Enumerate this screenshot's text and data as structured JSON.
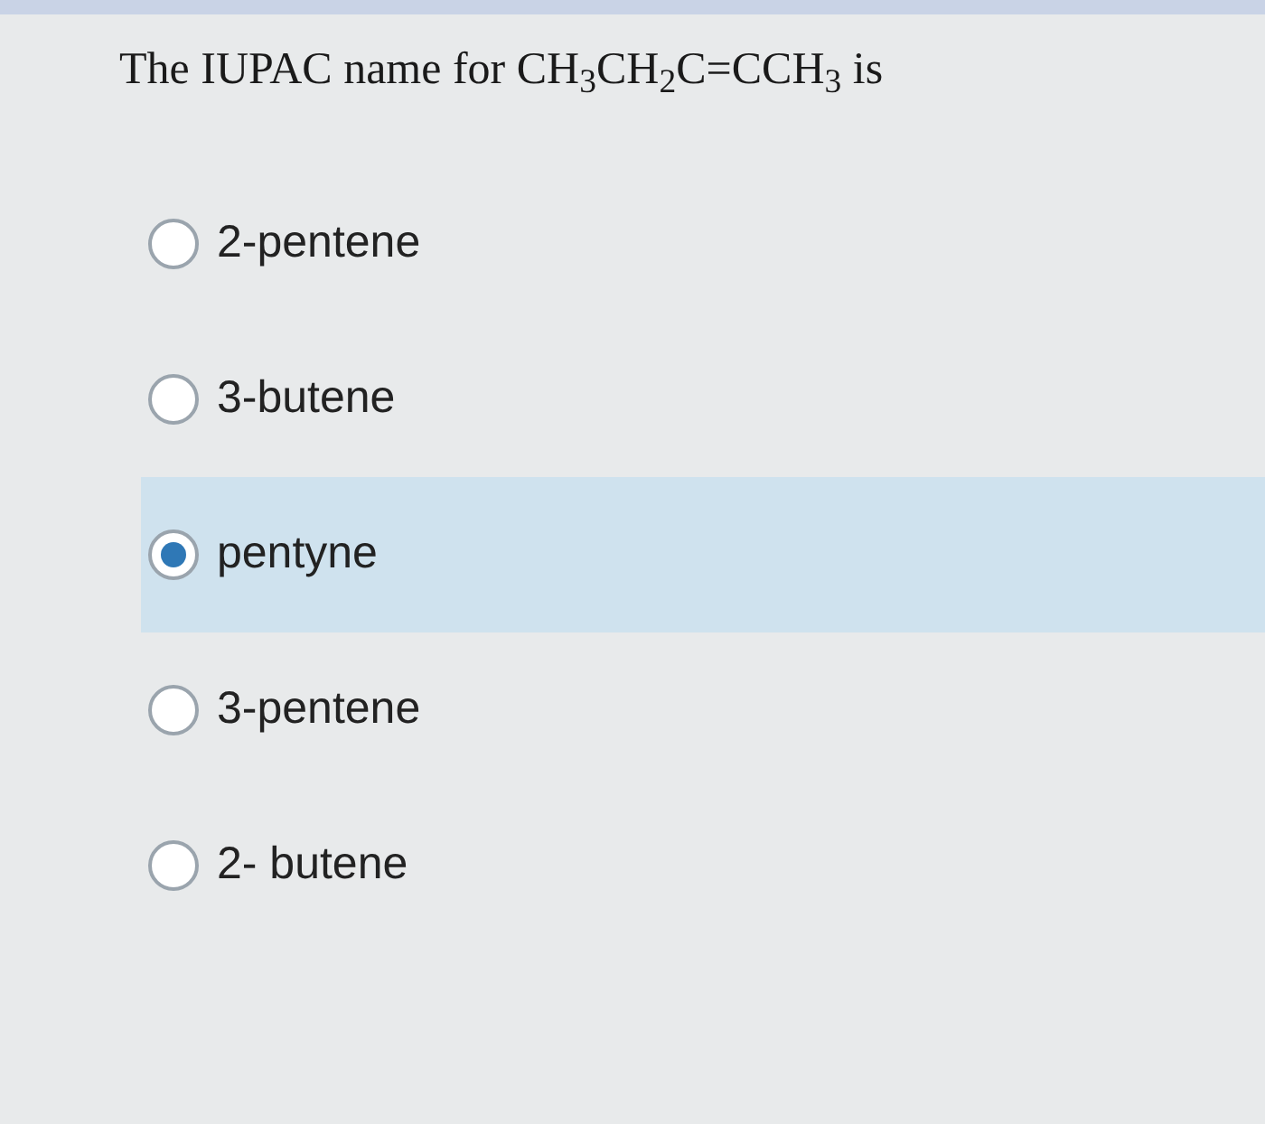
{
  "question": "The IUPAC name for CH$_{3}$CH$_{2}$C=CCH$_{3}$ is",
  "options": [
    {
      "label": "2-pentene",
      "selected": false
    },
    {
      "label": "3-butene",
      "selected": false
    },
    {
      "label": "pentyne",
      "selected": true
    },
    {
      "label": "3-pentene",
      "selected": false
    },
    {
      "label": "2- butene",
      "selected": false
    }
  ]
}
